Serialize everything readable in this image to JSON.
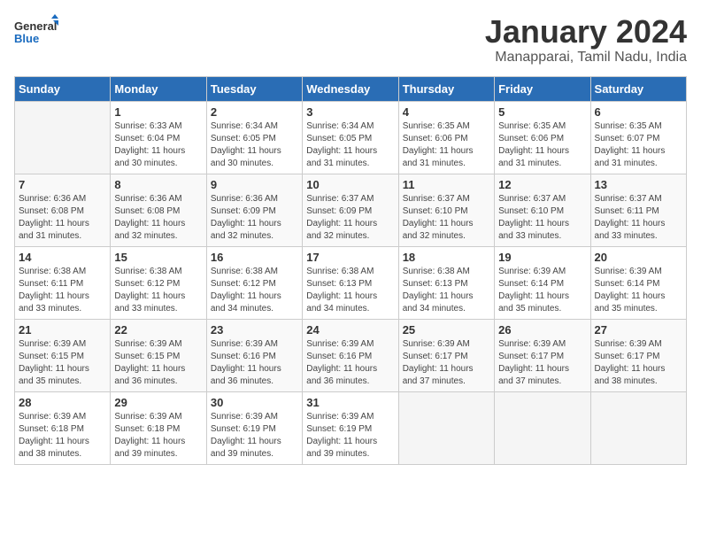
{
  "logo": {
    "general": "General",
    "blue": "Blue"
  },
  "title": "January 2024",
  "subtitle": "Manapparai, Tamil Nadu, India",
  "days_header": [
    "Sunday",
    "Monday",
    "Tuesday",
    "Wednesday",
    "Thursday",
    "Friday",
    "Saturday"
  ],
  "weeks": [
    [
      {
        "day": "",
        "info": ""
      },
      {
        "day": "1",
        "info": "Sunrise: 6:33 AM\nSunset: 6:04 PM\nDaylight: 11 hours\nand 30 minutes."
      },
      {
        "day": "2",
        "info": "Sunrise: 6:34 AM\nSunset: 6:05 PM\nDaylight: 11 hours\nand 30 minutes."
      },
      {
        "day": "3",
        "info": "Sunrise: 6:34 AM\nSunset: 6:05 PM\nDaylight: 11 hours\nand 31 minutes."
      },
      {
        "day": "4",
        "info": "Sunrise: 6:35 AM\nSunset: 6:06 PM\nDaylight: 11 hours\nand 31 minutes."
      },
      {
        "day": "5",
        "info": "Sunrise: 6:35 AM\nSunset: 6:06 PM\nDaylight: 11 hours\nand 31 minutes."
      },
      {
        "day": "6",
        "info": "Sunrise: 6:35 AM\nSunset: 6:07 PM\nDaylight: 11 hours\nand 31 minutes."
      }
    ],
    [
      {
        "day": "7",
        "info": "Sunrise: 6:36 AM\nSunset: 6:08 PM\nDaylight: 11 hours\nand 31 minutes."
      },
      {
        "day": "8",
        "info": "Sunrise: 6:36 AM\nSunset: 6:08 PM\nDaylight: 11 hours\nand 32 minutes."
      },
      {
        "day": "9",
        "info": "Sunrise: 6:36 AM\nSunset: 6:09 PM\nDaylight: 11 hours\nand 32 minutes."
      },
      {
        "day": "10",
        "info": "Sunrise: 6:37 AM\nSunset: 6:09 PM\nDaylight: 11 hours\nand 32 minutes."
      },
      {
        "day": "11",
        "info": "Sunrise: 6:37 AM\nSunset: 6:10 PM\nDaylight: 11 hours\nand 32 minutes."
      },
      {
        "day": "12",
        "info": "Sunrise: 6:37 AM\nSunset: 6:10 PM\nDaylight: 11 hours\nand 33 minutes."
      },
      {
        "day": "13",
        "info": "Sunrise: 6:37 AM\nSunset: 6:11 PM\nDaylight: 11 hours\nand 33 minutes."
      }
    ],
    [
      {
        "day": "14",
        "info": "Sunrise: 6:38 AM\nSunset: 6:11 PM\nDaylight: 11 hours\nand 33 minutes."
      },
      {
        "day": "15",
        "info": "Sunrise: 6:38 AM\nSunset: 6:12 PM\nDaylight: 11 hours\nand 33 minutes."
      },
      {
        "day": "16",
        "info": "Sunrise: 6:38 AM\nSunset: 6:12 PM\nDaylight: 11 hours\nand 34 minutes."
      },
      {
        "day": "17",
        "info": "Sunrise: 6:38 AM\nSunset: 6:13 PM\nDaylight: 11 hours\nand 34 minutes."
      },
      {
        "day": "18",
        "info": "Sunrise: 6:38 AM\nSunset: 6:13 PM\nDaylight: 11 hours\nand 34 minutes."
      },
      {
        "day": "19",
        "info": "Sunrise: 6:39 AM\nSunset: 6:14 PM\nDaylight: 11 hours\nand 35 minutes."
      },
      {
        "day": "20",
        "info": "Sunrise: 6:39 AM\nSunset: 6:14 PM\nDaylight: 11 hours\nand 35 minutes."
      }
    ],
    [
      {
        "day": "21",
        "info": "Sunrise: 6:39 AM\nSunset: 6:15 PM\nDaylight: 11 hours\nand 35 minutes."
      },
      {
        "day": "22",
        "info": "Sunrise: 6:39 AM\nSunset: 6:15 PM\nDaylight: 11 hours\nand 36 minutes."
      },
      {
        "day": "23",
        "info": "Sunrise: 6:39 AM\nSunset: 6:16 PM\nDaylight: 11 hours\nand 36 minutes."
      },
      {
        "day": "24",
        "info": "Sunrise: 6:39 AM\nSunset: 6:16 PM\nDaylight: 11 hours\nand 36 minutes."
      },
      {
        "day": "25",
        "info": "Sunrise: 6:39 AM\nSunset: 6:17 PM\nDaylight: 11 hours\nand 37 minutes."
      },
      {
        "day": "26",
        "info": "Sunrise: 6:39 AM\nSunset: 6:17 PM\nDaylight: 11 hours\nand 37 minutes."
      },
      {
        "day": "27",
        "info": "Sunrise: 6:39 AM\nSunset: 6:17 PM\nDaylight: 11 hours\nand 38 minutes."
      }
    ],
    [
      {
        "day": "28",
        "info": "Sunrise: 6:39 AM\nSunset: 6:18 PM\nDaylight: 11 hours\nand 38 minutes."
      },
      {
        "day": "29",
        "info": "Sunrise: 6:39 AM\nSunset: 6:18 PM\nDaylight: 11 hours\nand 39 minutes."
      },
      {
        "day": "30",
        "info": "Sunrise: 6:39 AM\nSunset: 6:19 PM\nDaylight: 11 hours\nand 39 minutes."
      },
      {
        "day": "31",
        "info": "Sunrise: 6:39 AM\nSunset: 6:19 PM\nDaylight: 11 hours\nand 39 minutes."
      },
      {
        "day": "",
        "info": ""
      },
      {
        "day": "",
        "info": ""
      },
      {
        "day": "",
        "info": ""
      }
    ]
  ]
}
